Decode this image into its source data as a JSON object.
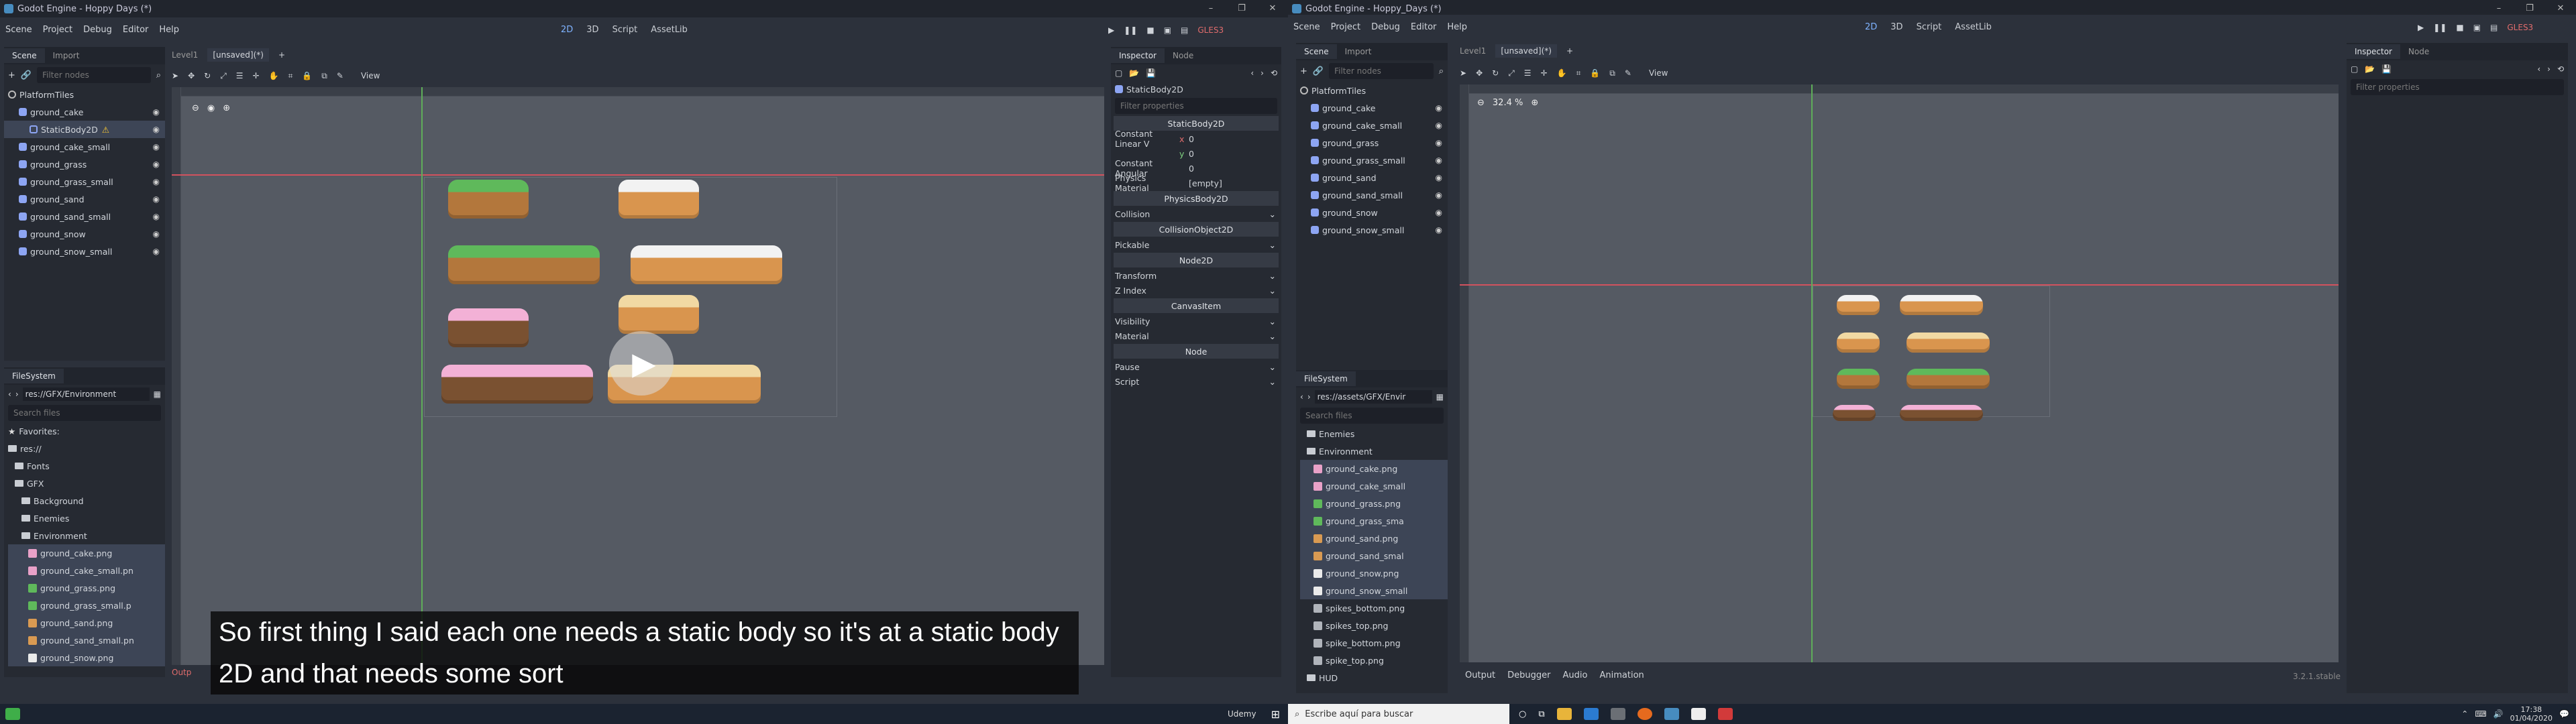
{
  "left": {
    "title": "Godot Engine - Hoppy Days (*)",
    "win_controls": [
      "–",
      "❐",
      "✕"
    ],
    "menu": [
      "Scene",
      "Project",
      "Debug",
      "Editor",
      "Help"
    ],
    "workspaces": [
      "2D",
      "3D",
      "Script",
      "AssetLib"
    ],
    "renderer": "GLES3",
    "scene_tabs": [
      "Scene",
      "Import"
    ],
    "filter_nodes": "Filter nodes",
    "tree": [
      {
        "label": "PlatformTiles",
        "type": "root"
      },
      {
        "label": "ground_cake",
        "type": "sprite"
      },
      {
        "label": "StaticBody2D",
        "type": "body"
      },
      {
        "label": "ground_cake_small",
        "type": "sprite"
      },
      {
        "label": "ground_grass",
        "type": "sprite"
      },
      {
        "label": "ground_grass_small",
        "type": "sprite"
      },
      {
        "label": "ground_sand",
        "type": "sprite"
      },
      {
        "label": "ground_sand_small",
        "type": "sprite"
      },
      {
        "label": "ground_snow",
        "type": "sprite"
      },
      {
        "label": "ground_snow_small",
        "type": "sprite"
      }
    ],
    "fs_title": "FileSystem",
    "fs_path": "res://GFX/Environment",
    "search_files": "Search files",
    "fs_items": [
      {
        "label": "Favorites:",
        "kind": "fav",
        "indent": 0
      },
      {
        "label": "res://",
        "kind": "folder",
        "indent": 0
      },
      {
        "label": "Fonts",
        "kind": "folder",
        "indent": 1
      },
      {
        "label": "GFX",
        "kind": "folder",
        "indent": 1
      },
      {
        "label": "Background",
        "kind": "folder",
        "indent": 2
      },
      {
        "label": "Enemies",
        "kind": "folder",
        "indent": 2
      },
      {
        "label": "Environment",
        "kind": "folder",
        "indent": 2
      },
      {
        "label": "ground_cake.png",
        "kind": "cake",
        "indent": 3
      },
      {
        "label": "ground_cake_small.pn",
        "kind": "cake",
        "indent": 3
      },
      {
        "label": "ground_grass.png",
        "kind": "grass",
        "indent": 3
      },
      {
        "label": "ground_grass_small.p",
        "kind": "grass",
        "indent": 3
      },
      {
        "label": "ground_sand.png",
        "kind": "sand",
        "indent": 3
      },
      {
        "label": "ground_sand_small.pn",
        "kind": "sand",
        "indent": 3
      },
      {
        "label": "ground_snow.png",
        "kind": "snow",
        "indent": 3
      }
    ],
    "editor_tabs": [
      "Level1",
      "[unsaved](*)"
    ],
    "view_label": "View",
    "bottom_tab": "Outp",
    "inspector": {
      "tabs": [
        "Inspector",
        "Node"
      ],
      "object": "StaticBody2D",
      "filter": "Filter properties",
      "class_header": "StaticBody2D",
      "rows": [
        {
          "label": "Constant Linear V",
          "axis": "x",
          "value": "0"
        },
        {
          "label": "",
          "axis": "y",
          "value": "0"
        },
        {
          "label": "Constant Angular",
          "axis": "",
          "value": "0"
        },
        {
          "label": "Physics Material",
          "axis": "",
          "value": "[empty]"
        }
      ],
      "sections": [
        {
          "kind": "header",
          "label": "PhysicsBody2D"
        },
        {
          "kind": "row",
          "label": "Collision"
        },
        {
          "kind": "header",
          "label": "CollisionObject2D"
        },
        {
          "kind": "row",
          "label": "Pickable"
        },
        {
          "kind": "header",
          "label": "Node2D"
        },
        {
          "kind": "row",
          "label": "Transform"
        },
        {
          "kind": "row",
          "label": "Z Index"
        },
        {
          "kind": "header",
          "label": "CanvasItem"
        },
        {
          "kind": "row",
          "label": "Visibility"
        },
        {
          "kind": "row",
          "label": "Material"
        },
        {
          "kind": "header",
          "label": "Node"
        },
        {
          "kind": "row",
          "label": "Pause"
        },
        {
          "kind": "row",
          "label": "Script"
        }
      ]
    },
    "caption": "So first thing I said each one needs a static body so it's at a static body 2D and that needs some sort"
  },
  "right": {
    "title": "Godot Engine - Hoppy_Days (*)",
    "win_controls": [
      "–",
      "❐",
      "✕"
    ],
    "menu": [
      "Scene",
      "Project",
      "Debug",
      "Editor",
      "Help"
    ],
    "workspaces": [
      "2D",
      "3D",
      "Script",
      "AssetLib"
    ],
    "renderer": "GLES3",
    "scene_tabs": [
      "Scene",
      "Import"
    ],
    "filter_nodes": "Filter nodes",
    "tree": [
      {
        "label": "PlatformTiles",
        "type": "root"
      },
      {
        "label": "ground_cake",
        "type": "sprite"
      },
      {
        "label": "ground_cake_small",
        "type": "sprite"
      },
      {
        "label": "ground_grass",
        "type": "sprite"
      },
      {
        "label": "ground_grass_small",
        "type": "sprite"
      },
      {
        "label": "ground_sand",
        "type": "sprite"
      },
      {
        "label": "ground_sand_small",
        "type": "sprite"
      },
      {
        "label": "ground_snow",
        "type": "sprite"
      },
      {
        "label": "ground_snow_small",
        "type": "sprite"
      }
    ],
    "fs_title": "FileSystem",
    "fs_path": "res://assets/GFX/Envir",
    "search_files": "Search files",
    "fs_items": [
      {
        "label": "Enemies",
        "kind": "folder",
        "indent": 1
      },
      {
        "label": "Environment",
        "kind": "folder",
        "indent": 1
      },
      {
        "label": "ground_cake.png",
        "kind": "cake",
        "indent": 2
      },
      {
        "label": "ground_cake_small",
        "kind": "cake",
        "indent": 2
      },
      {
        "label": "ground_grass.png",
        "kind": "grass",
        "indent": 2
      },
      {
        "label": "ground_grass_sma",
        "kind": "grass",
        "indent": 2
      },
      {
        "label": "ground_sand.png",
        "kind": "sand",
        "indent": 2
      },
      {
        "label": "ground_sand_smal",
        "kind": "sand",
        "indent": 2
      },
      {
        "label": "ground_snow.png",
        "kind": "snow",
        "indent": 2
      },
      {
        "label": "ground_snow_small",
        "kind": "snow",
        "indent": 2
      },
      {
        "label": "spikes_bottom.png",
        "kind": "spike",
        "indent": 2
      },
      {
        "label": "spikes_top.png",
        "kind": "spike",
        "indent": 2
      },
      {
        "label": "spike_bottom.png",
        "kind": "spike",
        "indent": 2
      },
      {
        "label": "spike_top.png",
        "kind": "spike",
        "indent": 2
      },
      {
        "label": "HUD",
        "kind": "folder",
        "indent": 1
      }
    ],
    "editor_tabs": [
      "Level1",
      "[unsaved](*)"
    ],
    "view_label": "View",
    "zoom": "32.4 %",
    "bottom_tabs": [
      "Output",
      "Debugger",
      "Audio",
      "Animation"
    ],
    "version": "3.2.1.stable",
    "inspector": {
      "tabs": [
        "Inspector",
        "Node"
      ],
      "filter": "Filter properties"
    }
  },
  "taskbar": {
    "search": "Escribe aquí para buscar",
    "udemy": "Udemy",
    "time": "17:38",
    "date": "01/04/2020"
  },
  "colors": {
    "accent": "#7fb3ff",
    "selection": "#3d4556",
    "guide_red": "#d2525e",
    "guide_green": "#5fae5a",
    "viewport_bg": "#555a63"
  }
}
